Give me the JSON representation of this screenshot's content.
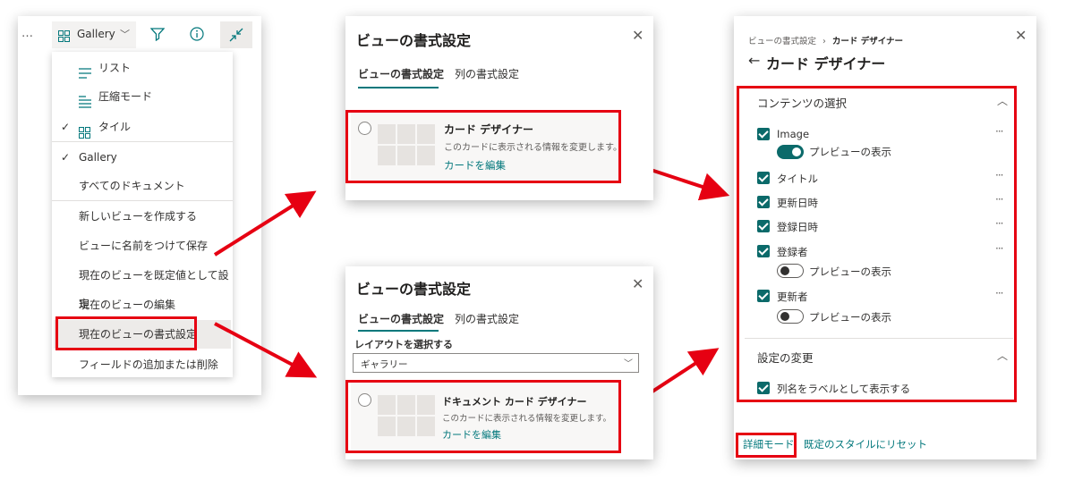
{
  "left_menu": {
    "dots": "…",
    "view_button": "Gallery",
    "items": [
      {
        "label": "リスト",
        "check": ""
      },
      {
        "label": "圧縮モード",
        "check": ""
      },
      {
        "label": "タイル",
        "check": "✓"
      },
      {
        "label": "Gallery",
        "check": "✓"
      },
      {
        "label": "すべてのドキュメント",
        "check": ""
      },
      {
        "label": "新しいビューを作成する",
        "check": ""
      },
      {
        "label": "ビューに名前をつけて保存",
        "check": ""
      },
      {
        "label": "現在のビューを既定値として設定",
        "check": ""
      },
      {
        "label": "現在のビューの編集",
        "check": ""
      },
      {
        "label": "現在のビューの書式設定",
        "check": ""
      },
      {
        "label": "フィールドの追加または削除",
        "check": ""
      }
    ],
    "highlighted_item": "現在のビューの書式設定"
  },
  "panel_top": {
    "title": "ビューの書式設定",
    "close": "✕",
    "tabs": [
      "ビューの書式設定",
      "列の書式設定"
    ],
    "card_title": "カード デザイナー",
    "card_desc": "このカードに表示される情報を変更します。",
    "card_link": "カードを編集"
  },
  "panel_bottom": {
    "title": "ビューの書式設定",
    "close": "✕",
    "tabs": [
      "ビューの書式設定",
      "列の書式設定"
    ],
    "layout_label": "レイアウトを選択する",
    "layout_value": "ギャラリー",
    "card_title": "ドキュメント カード デザイナー",
    "card_desc": "このカードに表示される情報を変更します。",
    "card_link": "カードを編集"
  },
  "panel_right": {
    "breadcrumb": [
      "ビューの書式設定",
      "カード デザイナー"
    ],
    "breadcrumb_sep": "›",
    "back_arrow": "←",
    "title": "カード デザイナー",
    "close": "✕",
    "section1": "コンテンツの選択",
    "fields": [
      {
        "label": "Image",
        "checked": true
      },
      {
        "label": "タイトル",
        "checked": true
      },
      {
        "label": "更新日時",
        "checked": true
      },
      {
        "label": "登録日時",
        "checked": true
      },
      {
        "label": "登録者",
        "checked": true
      },
      {
        "label": "更新者",
        "checked": true
      }
    ],
    "preview_label": "プレビューの表示",
    "preview_toggles": {
      "image": true,
      "registrant": false,
      "updater": false
    },
    "more": "···",
    "section2": "設定の変更",
    "option_label": "列名をラベルとして表示する",
    "advanced_link": "詳細モード",
    "reset_link": "既定のスタイルにリセット"
  },
  "colors": {
    "accent": "#03787c",
    "highlight": "#e60012",
    "checkbox": "#0b6a6a"
  }
}
